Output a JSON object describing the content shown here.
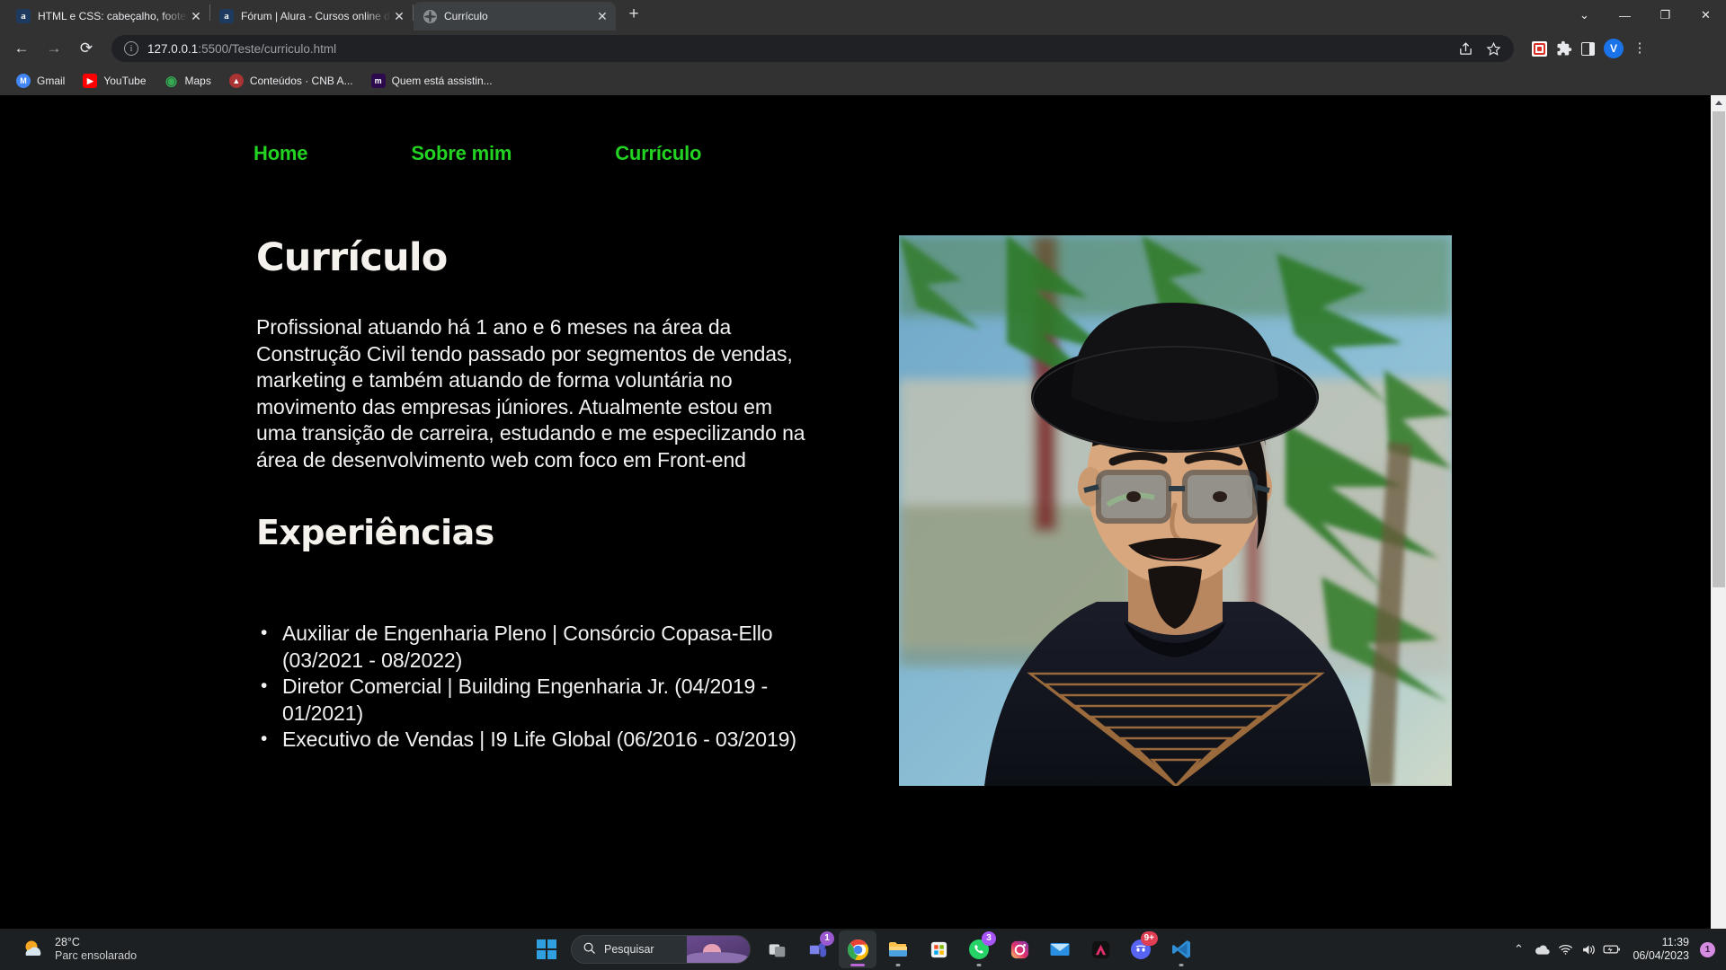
{
  "browser": {
    "tabs": [
      {
        "title": "HTML e CSS: cabeçalho, footer e",
        "favicon": "alura-icon",
        "active": false,
        "close_label": "✕"
      },
      {
        "title": "Fórum | Alura - Cursos online de",
        "favicon": "alura-icon",
        "active": false,
        "close_label": "✕"
      },
      {
        "title": "Currículo",
        "favicon": "globe-icon",
        "active": true,
        "close_label": "✕"
      }
    ],
    "new_tab_label": "+",
    "window_controls": {
      "minimize_group": "⌄",
      "minimize": "—",
      "maximize": "❐",
      "close": "✕"
    },
    "nav": {
      "back": "←",
      "forward": "→",
      "reload": "⟳"
    },
    "omnibox": {
      "info_icon_label": "ⓘ",
      "url_host": "127.0.0.1",
      "url_path": ":5500/Teste/curriculo.html",
      "share_icon": "share-icon",
      "bookmark_icon": "star-icon"
    },
    "toolbar_extras": {
      "extension_label": "extension-puzzle-icon",
      "side_panel_label": "side-panel-icon",
      "profile_initial": "V",
      "menu_label": "⋮"
    },
    "bookmarks": [
      {
        "label": "Gmail",
        "icon_text": "M",
        "icon_color": "#4285f4"
      },
      {
        "label": "YouTube",
        "icon_text": "▶",
        "icon_color": "#ff0000"
      },
      {
        "label": "Maps",
        "icon_text": "◉",
        "icon_color": "#34a853"
      },
      {
        "label": "Conteúdos · CNB A...",
        "icon_text": "▲",
        "icon_color": "#b03a3a"
      },
      {
        "label": "Quem está assistin...",
        "icon_text": "m",
        "icon_color": "#2d0a4e"
      }
    ]
  },
  "page": {
    "nav_links": [
      {
        "label": "Home"
      },
      {
        "label": "Sobre mim"
      },
      {
        "label": "Currículo"
      }
    ],
    "title": "Currículo",
    "bio": "Profissional atuando há 1 ano e 6 meses na área da Construção Civil tendo passado por segmentos de vendas, marketing e também atuando de forma voluntária no movimento das empresas júniores. Atualmente estou em uma transição de carreira, estudando e me especilizando na área de desenvolvimento web com foco em Front-end",
    "experience_title": "Experiências",
    "experiences": [
      "Auxiliar de Engenharia Pleno | Consórcio Copasa-Ello (03/2021 - 08/2022)",
      "Diretor Comercial | Building Engenharia Jr. (04/2019 - 01/2021)",
      "Executivo de Vendas | I9 Life Global (06/2016 - 03/2019)"
    ],
    "photo_alt": "profile-photo",
    "colors": {
      "background": "#000000",
      "nav_link": "#22d322",
      "heading": "#f5f2ee",
      "body_text": "#f2f2f2"
    }
  },
  "taskbar": {
    "weather": {
      "temperature": "28°C",
      "condition": "Parc ensolarado"
    },
    "start_label": "start-button",
    "search": {
      "placeholder": "Pesquisar"
    },
    "apps": [
      {
        "name": "task-view",
        "badge": ""
      },
      {
        "name": "microsoft-teams",
        "badge": "1",
        "badge_color": "#8b5cf6"
      },
      {
        "name": "google-chrome",
        "badge": "",
        "active": true
      },
      {
        "name": "file-explorer",
        "badge": ""
      },
      {
        "name": "microsoft-store",
        "badge": ""
      },
      {
        "name": "whatsapp",
        "badge": "3",
        "badge_color": "#a855f7"
      },
      {
        "name": "instagram",
        "badge": ""
      },
      {
        "name": "mail",
        "badge": ""
      },
      {
        "name": "adobe-app",
        "badge": ""
      },
      {
        "name": "discord",
        "badge": "9+",
        "badge_color": "#e03e52"
      },
      {
        "name": "visual-studio-code",
        "badge": ""
      }
    ],
    "tray": {
      "chevron": "⌃",
      "onedrive": "onedrive-icon",
      "wifi": "wifi-icon",
      "volume": "volume-icon",
      "battery": "battery-icon",
      "time": "11:39",
      "date": "06/04/2023",
      "notification_count": "1"
    }
  }
}
